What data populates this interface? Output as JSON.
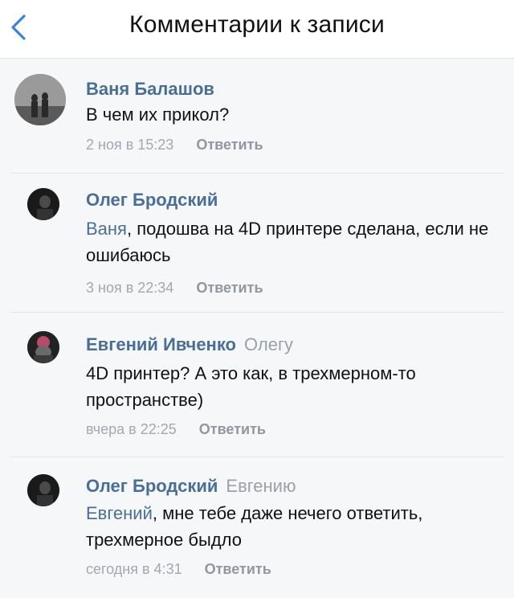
{
  "header": {
    "title": "Комментарии к записи"
  },
  "comments": [
    {
      "author": "Ваня Балашов",
      "reply_to": "",
      "mention": "",
      "text": "В чем их прикол?",
      "date": "2 ноя в 15:23",
      "reply_label": "Ответить"
    },
    {
      "author": "Олег Бродский",
      "reply_to": "",
      "mention": "Ваня",
      "text": ", подошва на 4D принтере сделана, если не ошибаюсь",
      "date": "3 ноя в 22:34",
      "reply_label": "Ответить"
    },
    {
      "author": "Евгений Ивченко",
      "reply_to": "Олегу",
      "mention": "",
      "text": "4D принтер? А это как, в трехмерном-то пространстве)",
      "date": "вчера в 22:25",
      "reply_label": "Ответить"
    },
    {
      "author": "Олег Бродский",
      "reply_to": "Евгению",
      "mention": "Евгений",
      "text": ", мне тебе даже нечего ответить, трехмерное быдло",
      "date": "сегодня в 4:31",
      "reply_label": "Ответить"
    }
  ],
  "colors": {
    "link": "#4a6f96",
    "meta": "#a2a8b0",
    "back_arrow": "#3b82d9"
  },
  "icons": {
    "back": "chevron-left-icon"
  }
}
